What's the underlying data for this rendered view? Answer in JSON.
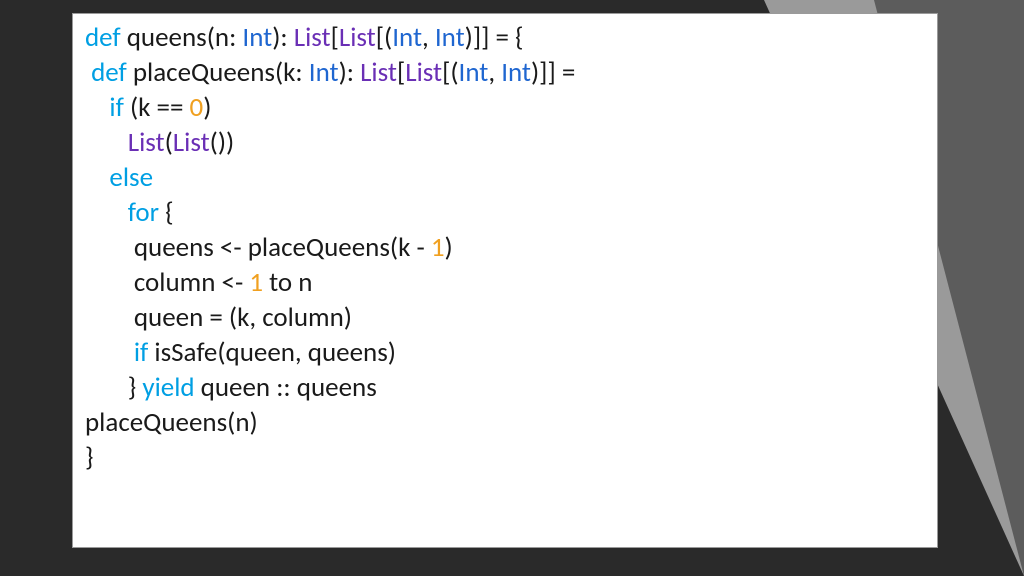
{
  "code": {
    "lines": [
      {
        "indent": 0,
        "tokens": [
          {
            "cls": "kw",
            "t": "def"
          },
          {
            "cls": "plain",
            "t": " queens(n: "
          },
          {
            "cls": "type",
            "t": "Int"
          },
          {
            "cls": "plain",
            "t": "): "
          },
          {
            "cls": "coll",
            "t": "List"
          },
          {
            "cls": "plain",
            "t": "["
          },
          {
            "cls": "coll",
            "t": "List"
          },
          {
            "cls": "plain",
            "t": "[("
          },
          {
            "cls": "type",
            "t": "Int"
          },
          {
            "cls": "plain",
            "t": ", "
          },
          {
            "cls": "type",
            "t": "Int"
          },
          {
            "cls": "plain",
            "t": ")]] = {"
          }
        ]
      },
      {
        "indent": 1,
        "tokens": [
          {
            "cls": "kw",
            "t": "def"
          },
          {
            "cls": "plain",
            "t": " placeQueens(k: "
          },
          {
            "cls": "type",
            "t": "Int"
          },
          {
            "cls": "plain",
            "t": "): "
          },
          {
            "cls": "coll",
            "t": "List"
          },
          {
            "cls": "plain",
            "t": "["
          },
          {
            "cls": "coll",
            "t": "List"
          },
          {
            "cls": "plain",
            "t": "[("
          },
          {
            "cls": "type",
            "t": "Int"
          },
          {
            "cls": "plain",
            "t": ", "
          },
          {
            "cls": "type",
            "t": "Int"
          },
          {
            "cls": "plain",
            "t": ")]] ="
          }
        ]
      },
      {
        "indent": 4,
        "tokens": [
          {
            "cls": "kw",
            "t": "if"
          },
          {
            "cls": "plain",
            "t": " (k == "
          },
          {
            "cls": "num",
            "t": "0"
          },
          {
            "cls": "plain",
            "t": ")"
          }
        ]
      },
      {
        "indent": 7,
        "tokens": [
          {
            "cls": "coll",
            "t": "List"
          },
          {
            "cls": "plain",
            "t": "("
          },
          {
            "cls": "coll",
            "t": "List"
          },
          {
            "cls": "plain",
            "t": "())"
          }
        ]
      },
      {
        "indent": 4,
        "tokens": [
          {
            "cls": "kw",
            "t": "else"
          }
        ]
      },
      {
        "indent": 7,
        "tokens": [
          {
            "cls": "kw",
            "t": "for"
          },
          {
            "cls": "plain",
            "t": " {"
          }
        ]
      },
      {
        "indent": 8,
        "tokens": [
          {
            "cls": "plain",
            "t": "queens <- placeQueens(k - "
          },
          {
            "cls": "num",
            "t": "1"
          },
          {
            "cls": "plain",
            "t": ")"
          }
        ]
      },
      {
        "indent": 8,
        "tokens": [
          {
            "cls": "plain",
            "t": "column <- "
          },
          {
            "cls": "num",
            "t": "1"
          },
          {
            "cls": "plain",
            "t": " to n"
          }
        ]
      },
      {
        "indent": 8,
        "tokens": [
          {
            "cls": "plain",
            "t": "queen = (k, column)"
          }
        ]
      },
      {
        "indent": 8,
        "tokens": [
          {
            "cls": "kw",
            "t": "if"
          },
          {
            "cls": "plain",
            "t": " isSafe(queen, queens)"
          }
        ]
      },
      {
        "indent": 7,
        "tokens": [
          {
            "cls": "plain",
            "t": "} "
          },
          {
            "cls": "kw",
            "t": "yield"
          },
          {
            "cls": "plain",
            "t": " queen :: queens"
          }
        ]
      },
      {
        "indent": 0,
        "tokens": [
          {
            "cls": "plain",
            "t": "placeQueens(n)"
          }
        ]
      },
      {
        "indent": 0,
        "tokens": [
          {
            "cls": "plain",
            "t": "}"
          }
        ]
      }
    ]
  }
}
